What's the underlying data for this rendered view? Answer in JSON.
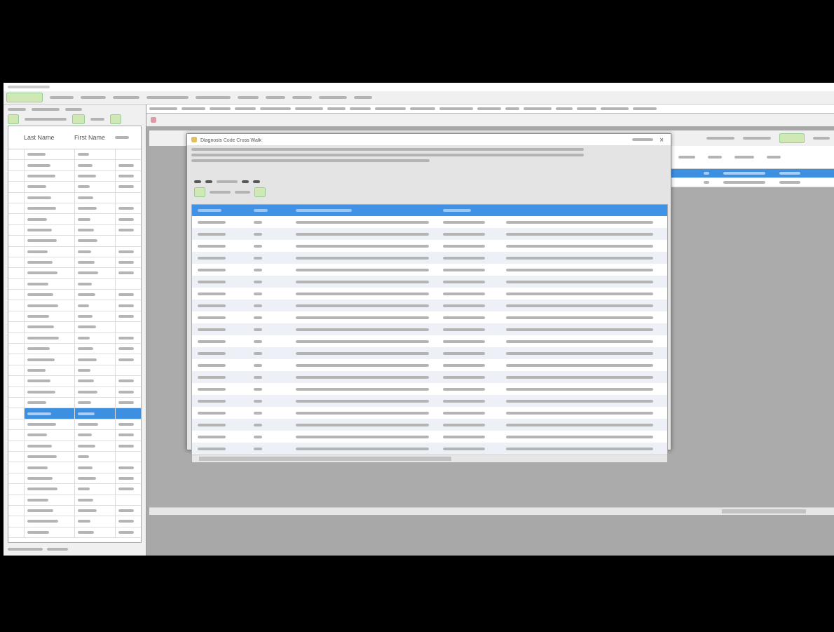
{
  "dialog": {
    "title": "Diagnosis Code Cross Walk",
    "close": "×"
  },
  "patient_list": {
    "columns": [
      "Last Name",
      "First Name"
    ],
    "rows": [
      {
        "selected": false
      },
      {
        "selected": false
      },
      {
        "selected": false
      },
      {
        "selected": false
      },
      {
        "selected": false
      },
      {
        "selected": false
      },
      {
        "selected": false
      },
      {
        "selected": false
      },
      {
        "selected": false
      },
      {
        "selected": false
      },
      {
        "selected": false
      },
      {
        "selected": false
      },
      {
        "selected": false
      },
      {
        "selected": false
      },
      {
        "selected": false
      },
      {
        "selected": false
      },
      {
        "selected": false
      },
      {
        "selected": false
      },
      {
        "selected": false
      },
      {
        "selected": false
      },
      {
        "selected": false
      },
      {
        "selected": false
      },
      {
        "selected": false
      },
      {
        "selected": false
      },
      {
        "selected": true
      },
      {
        "selected": false
      },
      {
        "selected": false
      },
      {
        "selected": false
      },
      {
        "selected": false
      },
      {
        "selected": false
      },
      {
        "selected": false
      },
      {
        "selected": false
      },
      {
        "selected": false
      },
      {
        "selected": false
      },
      {
        "selected": false
      },
      {
        "selected": false
      }
    ]
  },
  "encounter_grid": {
    "rows": [
      {
        "selected": true
      },
      {
        "selected": false
      }
    ]
  },
  "code_table": {
    "rows": [
      {
        "selected": false
      },
      {
        "selected": false
      },
      {
        "selected": false
      },
      {
        "selected": false
      },
      {
        "selected": false
      },
      {
        "selected": false
      },
      {
        "selected": false
      },
      {
        "selected": false
      },
      {
        "selected": false
      },
      {
        "selected": false
      },
      {
        "selected": false
      },
      {
        "selected": false
      },
      {
        "selected": false
      },
      {
        "selected": false
      },
      {
        "selected": false
      },
      {
        "selected": false
      },
      {
        "selected": false
      },
      {
        "selected": false
      },
      {
        "selected": false
      },
      {
        "selected": false
      }
    ]
  }
}
